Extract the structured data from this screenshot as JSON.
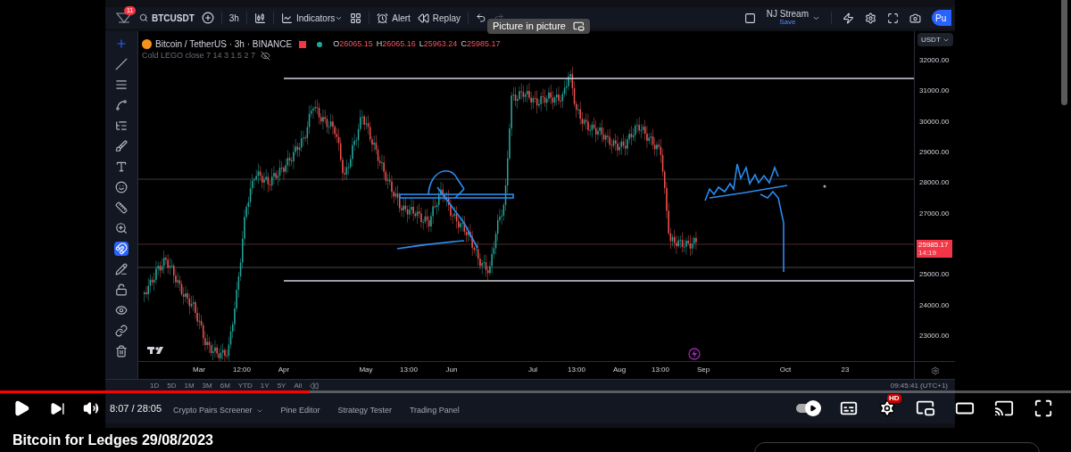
{
  "tradingview": {
    "toolbar": {
      "alerts_badge": "11",
      "symbol": "BTCUSDT",
      "interval": "3h",
      "buttons": [
        {
          "kind": "indicators",
          "label": "Indicators"
        },
        {
          "kind": "alert",
          "label": "Alert"
        },
        {
          "kind": "replay",
          "label": "Replay"
        }
      ],
      "layout_name": "NJ Stream",
      "layout_status": "Save",
      "publish_button": "Pu"
    },
    "tooltip": "Picture in picture",
    "legend": {
      "title": "Bitcoin / TetherUS · 3h · BINANCE",
      "ohlc": [
        {
          "key": "O",
          "value": "26065.15"
        },
        {
          "key": "H",
          "value": "26065.16"
        },
        {
          "key": "L",
          "value": "25963.24"
        },
        {
          "key": "C",
          "value": "25985.17"
        }
      ],
      "indicator": "Cold LEGO close 7 14 3 1.5 2 7"
    },
    "drawing_tools": [
      {
        "kind": "crosshair",
        "active": true
      },
      {
        "kind": "trend-line",
        "active": false
      },
      {
        "kind": "fib",
        "active": false
      },
      {
        "kind": "pattern",
        "active": false
      },
      {
        "kind": "projection",
        "active": false
      },
      {
        "kind": "brush",
        "active": false
      },
      {
        "kind": "text",
        "active": false
      },
      {
        "kind": "emoji",
        "active": false
      },
      {
        "kind": "ruler",
        "active": false
      },
      {
        "kind": "zoom",
        "active": false
      },
      {
        "kind": "magnet",
        "active": true
      },
      {
        "kind": "pencil-lock",
        "active": false
      },
      {
        "kind": "lock",
        "active": false
      },
      {
        "kind": "eye",
        "active": false
      },
      {
        "kind": "link",
        "active": false
      },
      {
        "kind": "trash",
        "active": false
      }
    ],
    "currency": "USDT",
    "price_ticks": [
      "32000.00",
      "31000.00",
      "30000.00",
      "29000.00",
      "28000.00",
      "27000.00",
      "25000.00",
      "24000.00",
      "23000.00"
    ],
    "last_price": {
      "value": "25985.17",
      "countdown": "14:19"
    },
    "time_ticks": [
      "Mar",
      "12:00",
      "Apr",
      "May",
      "13:00",
      "Jun",
      "Jul",
      "13:00",
      "Aug",
      "13:00",
      "Sep",
      "Oct",
      "23"
    ],
    "ranges": [
      "1D",
      "5D",
      "1M",
      "3M",
      "6M",
      "YTD",
      "1Y",
      "5Y",
      "All"
    ],
    "clock": "09:45:41 (UTC+1)",
    "panels": [
      {
        "label": "Crypto Pairs Screener",
        "dropdown": true
      },
      {
        "label": "Pine Editor",
        "dropdown": false
      },
      {
        "label": "Strategy Tester",
        "dropdown": false
      },
      {
        "label": "Trading Panel",
        "dropdown": false
      }
    ]
  },
  "player": {
    "progress": {
      "level": 0.289
    },
    "autoplay": {
      "on": true
    },
    "time": "8:07 / 28:05",
    "settings_badge": "HD"
  },
  "title": "Bitcoin for Ledges 29/08/2023"
}
